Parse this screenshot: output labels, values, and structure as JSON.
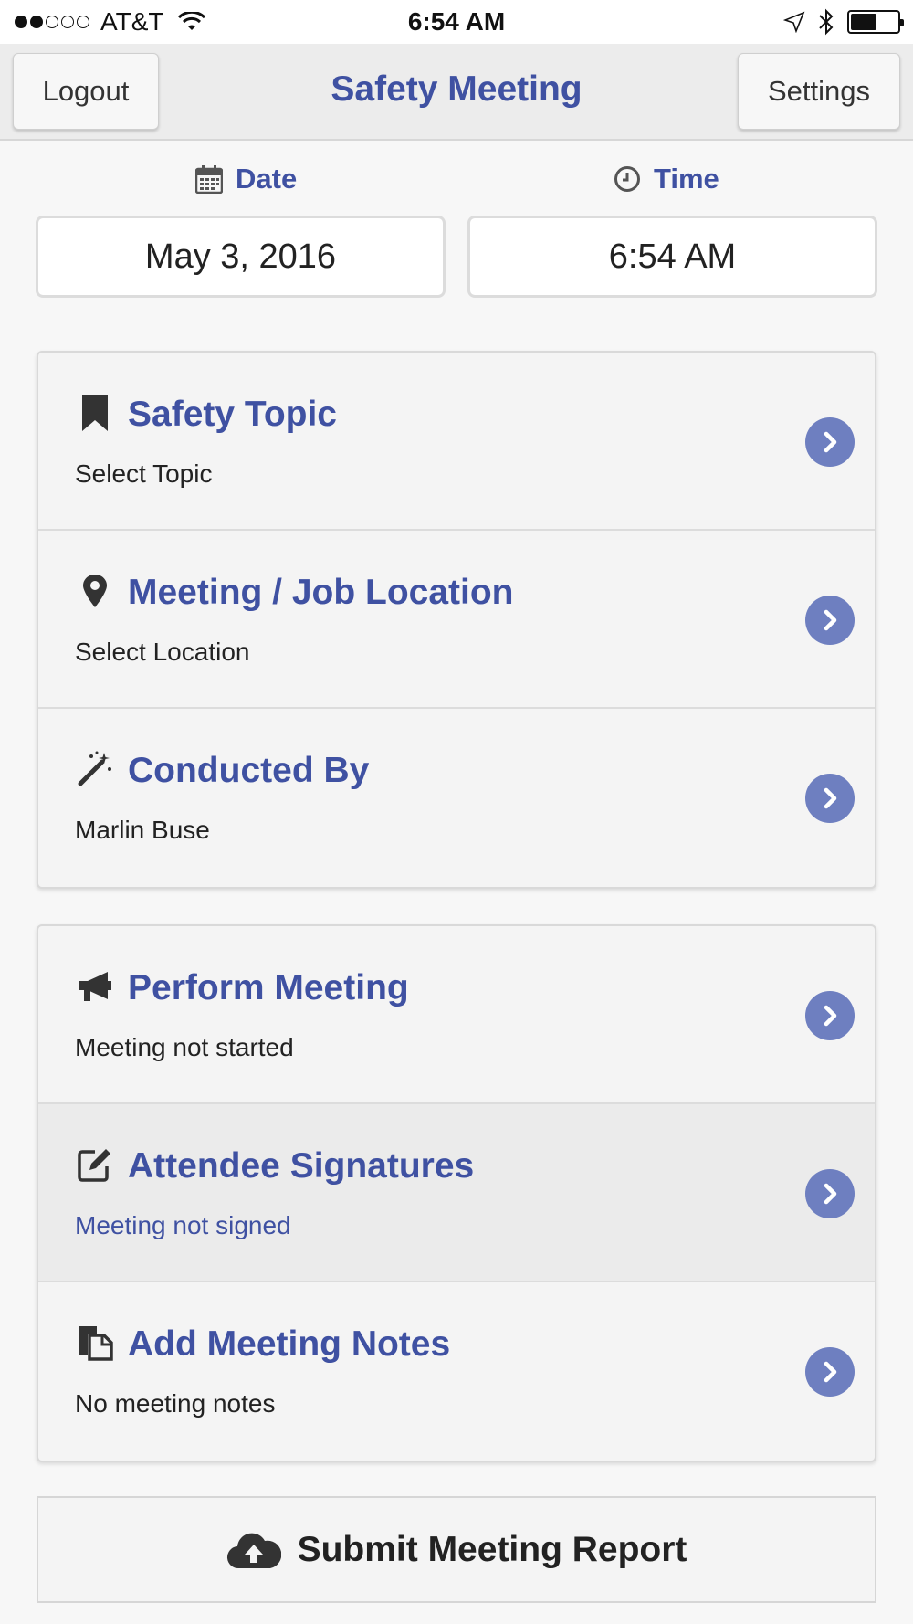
{
  "status_bar": {
    "carrier": "AT&T",
    "time": "6:54 AM",
    "signal_bars_filled": 2,
    "signal_bars_total": 5,
    "battery_level": 0.55
  },
  "nav": {
    "logout_label": "Logout",
    "title": "Safety Meeting",
    "settings_label": "Settings"
  },
  "datetime": {
    "date_label": "Date",
    "time_label": "Time",
    "date_value": "May 3, 2016",
    "time_value": "6:54 AM"
  },
  "details": {
    "topic": {
      "title": "Safety Topic",
      "subtitle": "Select Topic",
      "icon": "bookmark-icon"
    },
    "location": {
      "title": "Meeting / Job Location",
      "subtitle": "Select Location",
      "icon": "map-marker-icon"
    },
    "conductor": {
      "title": "Conducted By",
      "subtitle": "Marlin Buse",
      "icon": "magic-wand-icon"
    }
  },
  "actions": {
    "perform": {
      "title": "Perform Meeting",
      "subtitle": "Meeting not started",
      "icon": "megaphone-icon"
    },
    "signatures": {
      "title": "Attendee Signatures",
      "subtitle": "Meeting not signed",
      "icon": "edit-icon"
    },
    "notes": {
      "title": "Add Meeting Notes",
      "subtitle": "No meeting notes",
      "icon": "notes-icon"
    }
  },
  "submit": {
    "label": "Submit Meeting Report",
    "icon": "cloud-upload-icon"
  },
  "colors": {
    "accent": "#3f51a2",
    "chevron": "#6e7fc0",
    "background": "#f7f7f7"
  }
}
